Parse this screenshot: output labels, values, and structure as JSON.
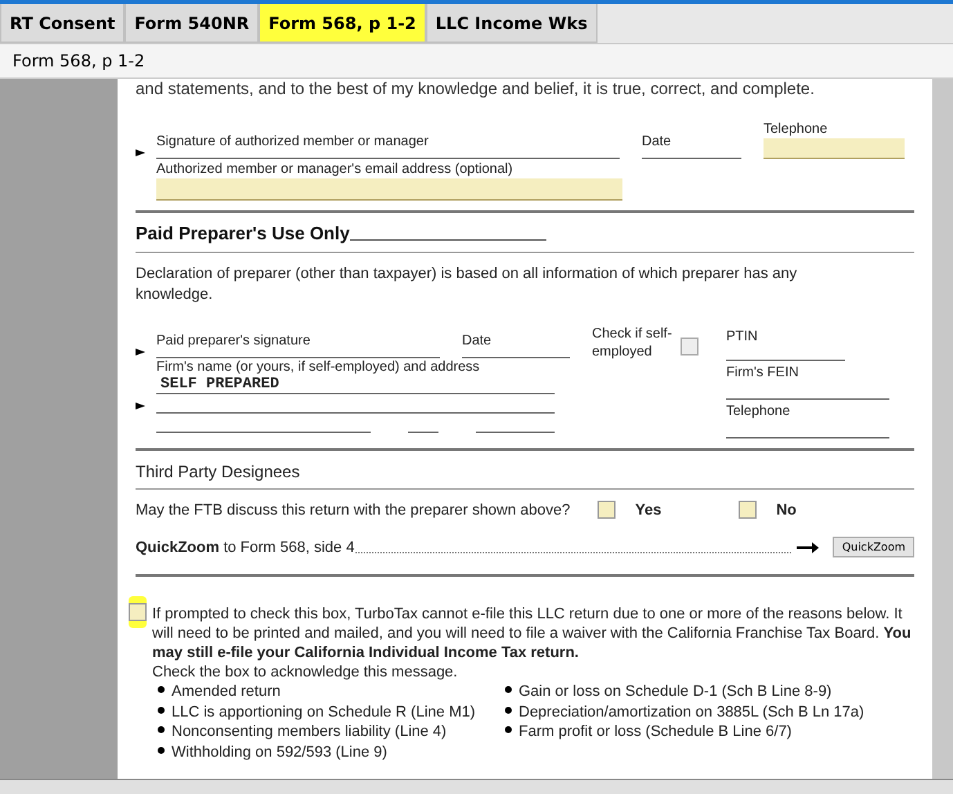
{
  "tabs": [
    {
      "label": "RT Consent",
      "selected": false
    },
    {
      "label": "Form 540NR",
      "selected": false
    },
    {
      "label": "Form 568, p 1-2",
      "selected": true
    },
    {
      "label": "LLC Income Wks",
      "selected": false
    }
  ],
  "form_title": "Form 568, p 1-2",
  "top_text": "and statements, and to the best of my knowledge and belief, it is true, correct, and complete.",
  "member": {
    "signature_label": "Signature of authorized member or manager",
    "date_label": "Date",
    "telephone_label": "Telephone",
    "email_label": "Authorized member or manager's email address (optional)"
  },
  "preparer": {
    "heading": "Paid Preparer's Use Only",
    "declaration": "Declaration of preparer (other than taxpayer) is based on all information of which preparer has any knowledge.",
    "signature_label": "Paid preparer's signature",
    "date_label": "Date",
    "self_employed_label": "Check if self-employed",
    "self_employed_checked": false,
    "ptin_label": "PTIN",
    "firm_label": "Firm's name (or yours, if self-employed) and address",
    "firm_value": "SELF PREPARED",
    "fein_label": "Firm's FEIN",
    "telephone_label": "Telephone"
  },
  "third_party": {
    "heading": "Third Party Designees",
    "question": "May the FTB discuss this return with the preparer shown above?",
    "options": [
      {
        "label": "Yes",
        "checked": false
      },
      {
        "label": "No",
        "checked": false
      }
    ]
  },
  "quickzoom": {
    "text": "**QuickZoom** to Form 568, side 4",
    "button": "QuickZoom"
  },
  "notice": {
    "checked": false,
    "text": "If prompted to check this box, TurboTax cannot e-file this LLC return due to one or more of the reasons below. It will need to be printed and mailed, and you will need to file a waiver with the California Franchise Tax Board. **You may still e-file your California Individual Income Tax return.**",
    "instruction": "Check the box to acknowledge this message.",
    "reasons": [
      [
        "Amended return",
        "LLC is apportioning on Schedule R (Line M1)",
        "Nonconsenting members liability (Line 4)",
        "Withholding on 592/593 (Line 9)"
      ],
      [
        "Gain or loss on Schedule D-1 (Sch B Line 8-9)",
        "Depreciation/amortization on 3885L (Sch B Ln 17a)",
        "Farm profit or loss (Schedule B Line 6/7)"
      ]
    ]
  }
}
